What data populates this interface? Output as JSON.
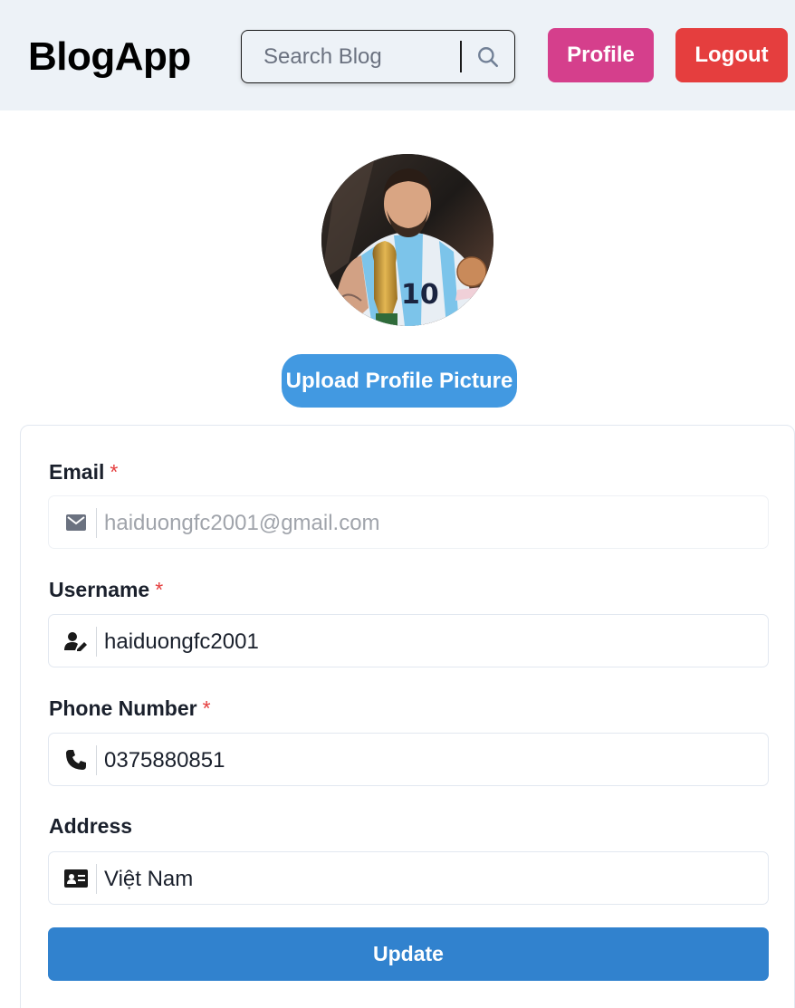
{
  "header": {
    "logo": "BlogApp",
    "search_placeholder": "Search Blog",
    "profile_label": "Profile",
    "logout_label": "Logout"
  },
  "profile": {
    "upload_label": "Upload Profile Picture"
  },
  "form": {
    "email": {
      "label": "Email",
      "required_mark": "*",
      "value": "haiduongfc2001@gmail.com",
      "icon": "envelope-icon"
    },
    "username": {
      "label": "Username",
      "required_mark": "*",
      "value": "haiduongfc2001",
      "icon": "user-edit-icon"
    },
    "phone": {
      "label": "Phone Number",
      "required_mark": "*",
      "value": "0375880851",
      "icon": "phone-icon"
    },
    "address": {
      "label": "Address",
      "value": "Việt Nam",
      "icon": "id-card-icon"
    },
    "submit_label": "Update"
  },
  "colors": {
    "header_bg": "#edf2f7",
    "profile_btn": "#d53f8c",
    "logout_btn": "#e53e3e",
    "upload_btn": "#4299e1",
    "update_btn": "#3182ce",
    "required": "#e53e3e"
  }
}
